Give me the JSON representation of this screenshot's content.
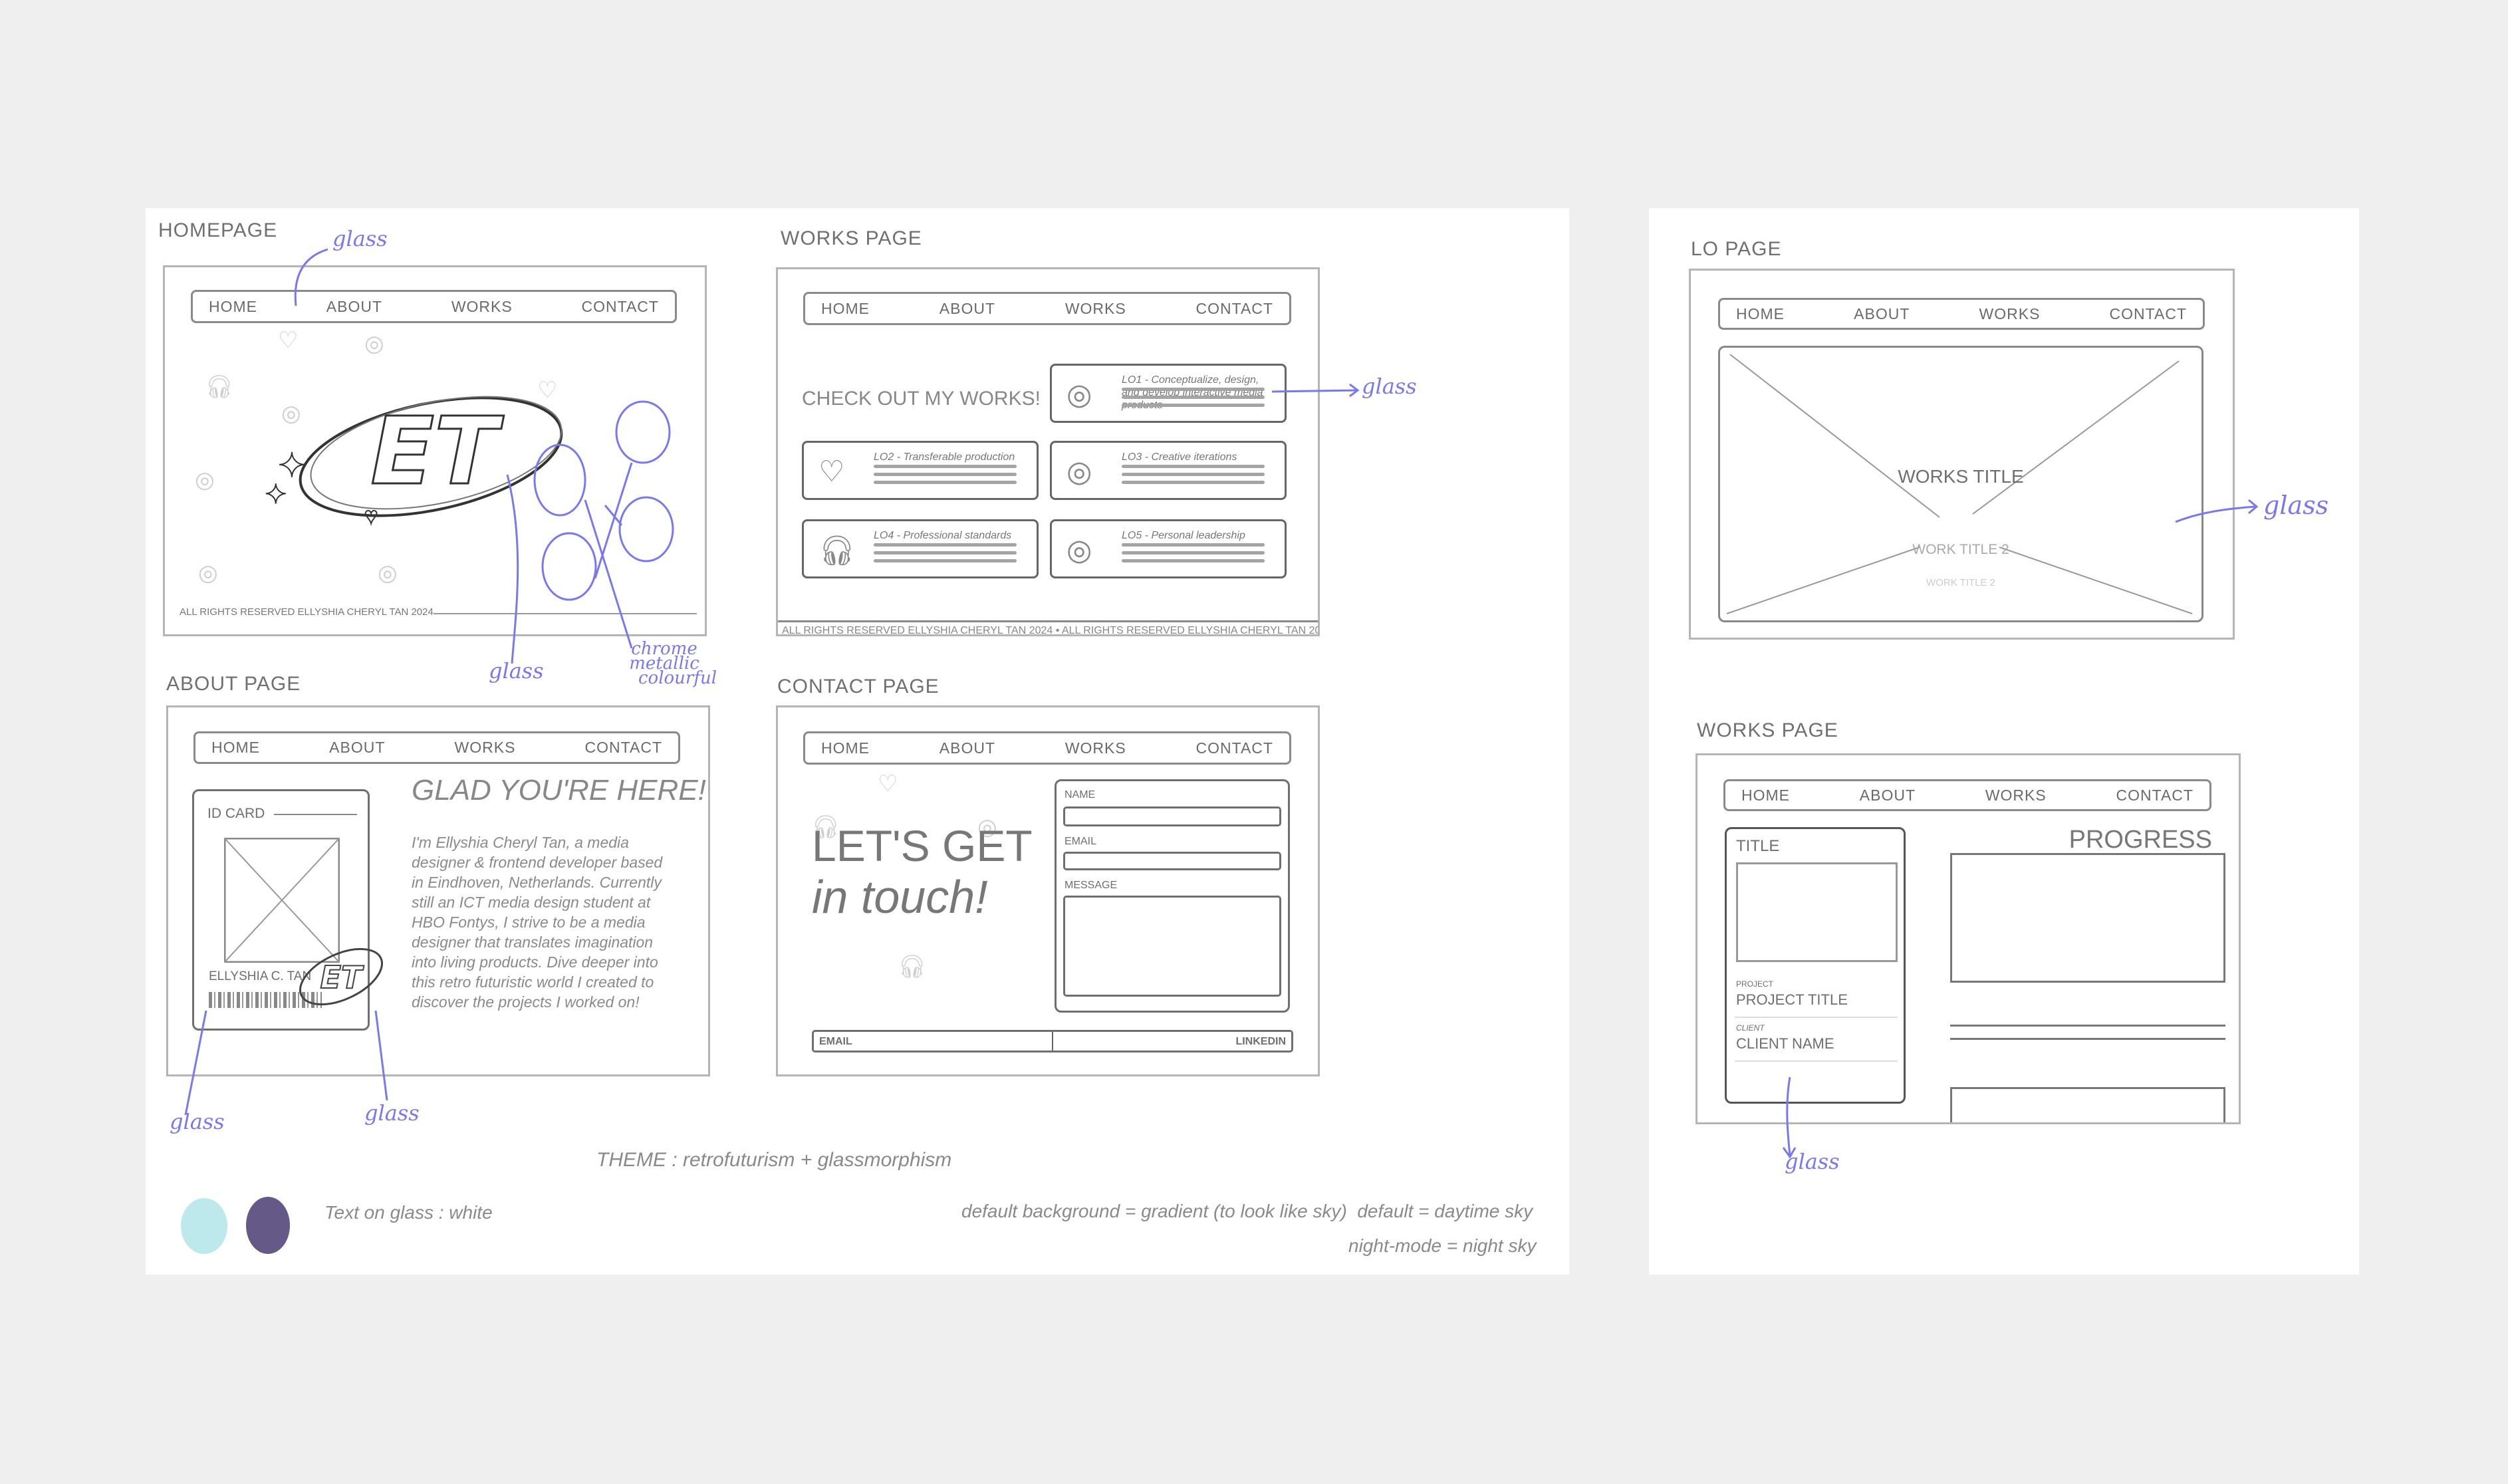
{
  "nav": {
    "items": [
      "Home",
      "About",
      "Works",
      "Contact"
    ]
  },
  "homepage": {
    "label": "Homepage",
    "logo_text": "ET",
    "footer": "All rights reserved Ellyshia Cheryl Tan 2024"
  },
  "works_page": {
    "label": "Works page",
    "heading": "CHECK OUT MY WORKS!",
    "cards": [
      {
        "title": "LO1 - Conceptualize, design, and develop interactive media products",
        "icon": "planet-heart-icon"
      },
      {
        "title": "LO2 - Transferable production",
        "icon": "heart-arrow-icon"
      },
      {
        "title": "LO3 - Creative iterations",
        "icon": "planet-heart-icon"
      },
      {
        "title": "LO4 - Professional standards",
        "icon": "headphones-icon"
      },
      {
        "title": "LO5 - Personal leadership",
        "icon": "planet-heart-icon"
      }
    ],
    "footer": "All rights reserved Ellyshia Cheryl Tan 2024 • All rights reserved Ellyshia Cheryl Tan 2024 • All"
  },
  "about_page": {
    "label": "About page",
    "id_card_label": "ID CARD",
    "id_name": "ELLYSHIA C. TAN",
    "heading": "GLAD YOU'RE HERE!",
    "body": "I'm Ellyshia Cheryl Tan, a media designer & frontend developer based in Eindhoven, Netherlands. Currently still an ICT media design student at HBO Fontys, I strive to be a media designer that translates imagination into living products. Dive deeper into this retro futuristic world I created to discover the projects I worked on!"
  },
  "contact_page": {
    "label": "Contact page",
    "heading_line1": "LET'S GET",
    "heading_line2": "in touch!",
    "form": {
      "name_label": "NAME",
      "email_label": "EMAIL",
      "message_label": "MESSAGE"
    },
    "footer_left": "EMAIL",
    "footer_right": "LINKEDIN"
  },
  "lo_page": {
    "label": "LO page",
    "title": "WORKS TITLE",
    "subtitle": "WORK TITLE 2",
    "subtitle_faint": "WORK TITLE 2"
  },
  "works_detail_page": {
    "label": "Works page",
    "card_title": "TITLE",
    "project_label": "Project",
    "project_value": "PROJECT TITLE",
    "client_label": "Client",
    "client_value": "CLIENT NAME",
    "progress_heading": "PROGRESS"
  },
  "annotations": {
    "glass": "glass",
    "chrome": [
      "chrome",
      "metallic",
      "colourful"
    ]
  },
  "theme": {
    "title": "THEME : retrofuturism + glassmorphism",
    "text_on_glass": "Text on glass : white",
    "background_note": "default background = gradient (to look like sky)  default = daytime sky",
    "night_note": "night-mode = night sky",
    "swatches": [
      "#bde8ec",
      "#655a87"
    ]
  },
  "colors": {
    "annotation": "#7a78f0",
    "sketch": "#6f6f6f"
  }
}
